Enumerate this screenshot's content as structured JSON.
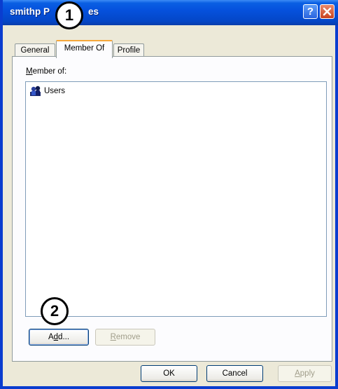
{
  "window": {
    "title_left": "smithp P",
    "title_right": "es",
    "help_glyph": "?",
    "colors": {
      "titlebar": "#0551dd",
      "face": "#ece9d8",
      "tab_highlight": "#f5a73a"
    }
  },
  "tabs": [
    {
      "label": "General",
      "active": false
    },
    {
      "label": "Member Of",
      "active": true
    },
    {
      "label": "Profile",
      "active": false
    }
  ],
  "member_of": {
    "label": "Member of:",
    "items": [
      {
        "label": "Users",
        "icon": "group-icon"
      }
    ]
  },
  "buttons": {
    "add": "Add...",
    "remove": "Remove",
    "ok": "OK",
    "cancel": "Cancel",
    "apply": "Apply"
  },
  "callouts": [
    "1",
    "2"
  ]
}
